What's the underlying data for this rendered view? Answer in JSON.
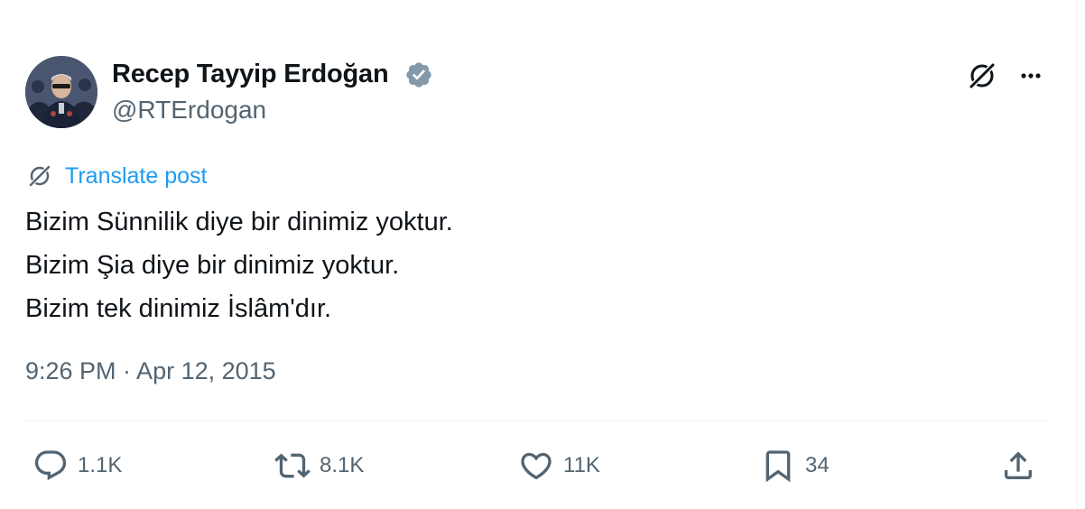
{
  "tweet": {
    "author": {
      "display_name": "Recep Tayyip Erdoğan",
      "handle": "@RTErdogan",
      "verified": true
    },
    "translate_label": "Translate post",
    "text_lines": [
      "Bizim Sünnilik diye bir dinimiz yoktur.",
      "Bizim Şia diye bir dinimiz yoktur.",
      "Bizim tek dinimiz İslâm'dır."
    ],
    "timestamp": "9:26 PM · Apr 12, 2015",
    "metrics": {
      "replies": "1.1K",
      "reposts": "8.1K",
      "likes": "11K",
      "bookmarks": "34"
    }
  },
  "colors": {
    "text": "#0f1419",
    "secondary": "#536471",
    "link": "#1d9bf0",
    "verified_badge": "#829aab",
    "divider": "#eff3f4"
  },
  "icons": {
    "grok": "grok-icon",
    "more": "more-icon",
    "translate": "translate-icon",
    "reply": "reply-icon",
    "repost": "repost-icon",
    "like": "heart-icon",
    "bookmark": "bookmark-icon",
    "share": "share-icon"
  }
}
